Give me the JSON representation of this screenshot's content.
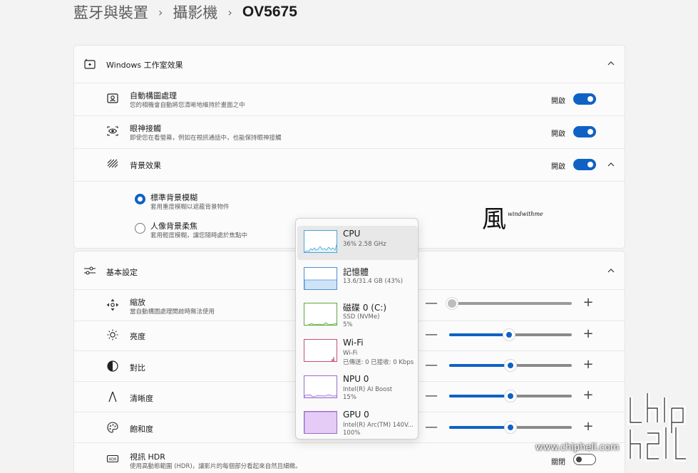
{
  "breadcrumb": {
    "items": [
      "藍牙與裝置",
      "攝影機"
    ],
    "current": "OV5675",
    "separator": "›"
  },
  "studio_effects": {
    "title": "Windows 工作室效果",
    "items": [
      {
        "title": "自動構圖處理",
        "subtitle": "您的相機會自動將您清晰地維持於畫面之中",
        "state": "開啟",
        "on": true
      },
      {
        "title": "眼神接觸",
        "subtitle": "即使您在看螢幕，例如在視訊通話中，也能保持眼神接觸",
        "state": "開啟",
        "on": true
      }
    ],
    "background": {
      "title": "背景效果",
      "state": "開啟",
      "on": true,
      "options": [
        {
          "title": "標準背景模糊",
          "subtitle": "套用重度模糊以遮蔽背景物件",
          "selected": true
        },
        {
          "title": "人像背景柔焦",
          "subtitle": "套用輕度模糊，讓您隨時處於焦點中",
          "selected": false
        }
      ]
    }
  },
  "basic": {
    "title": "基本設定",
    "rows": [
      {
        "title": "縮放",
        "subtitle": "當自動構圖處理開啟時無法使用",
        "level": 0,
        "disabled": true
      },
      {
        "title": "亮度",
        "subtitle": "",
        "level": 0.49,
        "disabled": false
      },
      {
        "title": "對比",
        "subtitle": "",
        "level": 0.5,
        "disabled": false
      },
      {
        "title": "清晰度",
        "subtitle": "",
        "level": 0.5,
        "disabled": false
      },
      {
        "title": "飽和度",
        "subtitle": "",
        "level": 0.5,
        "disabled": false
      }
    ],
    "hdr": {
      "title": "視訊 HDR",
      "subtitle": "使用高動態範圍 (HDR)，讓影片的每個部分看起來自然且細緻。",
      "state": "關閉",
      "on": false
    }
  },
  "slider_symbols": {
    "minus": "—",
    "plus": "+"
  },
  "task_manager": {
    "items": [
      {
        "name": "CPU",
        "lines": [
          "36%  2.58 GHz"
        ],
        "color": "#4aa3d6",
        "fill": "#dff0fa",
        "selected": true
      },
      {
        "name": "記憶體",
        "lines": [
          "13.6/31.4 GB (43%)"
        ],
        "color": "#4a90d6",
        "fill": "#cfe3f7",
        "selected": false
      },
      {
        "name": "磁碟 0 (C:)",
        "lines": [
          "SSD (NVMe)",
          "5%"
        ],
        "color": "#5fa83a",
        "fill": "#e2f2d6",
        "selected": false
      },
      {
        "name": "Wi-Fi",
        "lines": [
          "Wi-Fi",
          "已傳送: 0  已接收: 0 Kbps"
        ],
        "color": "#c4507a",
        "fill": "#fbe5ee",
        "selected": false
      },
      {
        "name": "NPU 0",
        "lines": [
          "Intel(R) AI Boost",
          "15%"
        ],
        "color": "#9a6cc8",
        "fill": "#efe3fa",
        "selected": false
      },
      {
        "name": "GPU 0",
        "lines": [
          "Intel(R) Arc(TM) 140V...",
          "100%"
        ],
        "color": "#9a6cc8",
        "fill": "#e4ccf7",
        "selected": false
      }
    ]
  },
  "watermarks": {
    "brand_glyph": "風",
    "brand_sub": "windwithme",
    "site": "www.chiphell.com",
    "chip_logo": "chip hell"
  },
  "colors": {
    "accent": "#0f62c4",
    "background": "#f3f3f3",
    "card": "#fbfbfb"
  }
}
